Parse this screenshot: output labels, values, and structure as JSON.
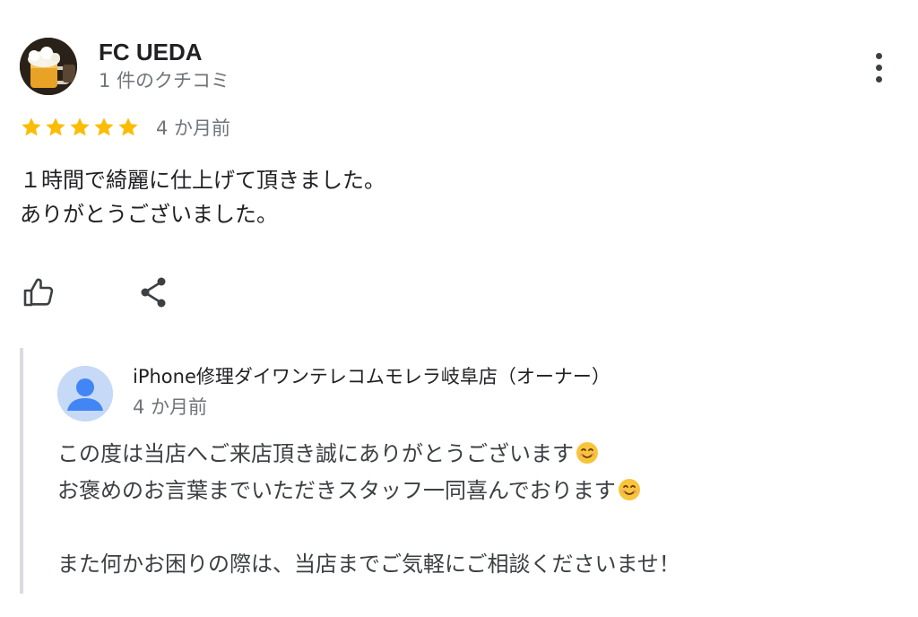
{
  "review": {
    "author": {
      "name": "FC UEDA",
      "review_count": "1 件のクチコミ",
      "avatar_icon": "beer-mug-avatar"
    },
    "menu_icon": "more-vert-icon",
    "rating": 5,
    "time": "4 か月前",
    "text": "１時間で綺麗に仕上げて頂きました。\nありがとうございました。",
    "actions": {
      "like_icon": "thumb-up-icon",
      "share_icon": "share-icon"
    }
  },
  "owner_reply": {
    "name": "iPhone修理ダイワンテレコムモレラ岐阜店（オーナー）",
    "time": "4 か月前",
    "avatar_icon": "default-person-avatar",
    "lines": [
      "この度は当店へご来店頂き誠にありがとうございます",
      "お褒めのお言葉までいただきスタッフ一同喜んでおります",
      "",
      "また何かお困りの際は、当店までご気軽にご相談くださいませ！"
    ],
    "emoji": "smiling-face-emoji"
  },
  "colors": {
    "star": "#fbbc04",
    "secondary_text": "#70757a",
    "reply_border": "#dadce0",
    "owner_avatar_bg": "#c6d9f6",
    "owner_avatar_fg": "#4285f4"
  }
}
